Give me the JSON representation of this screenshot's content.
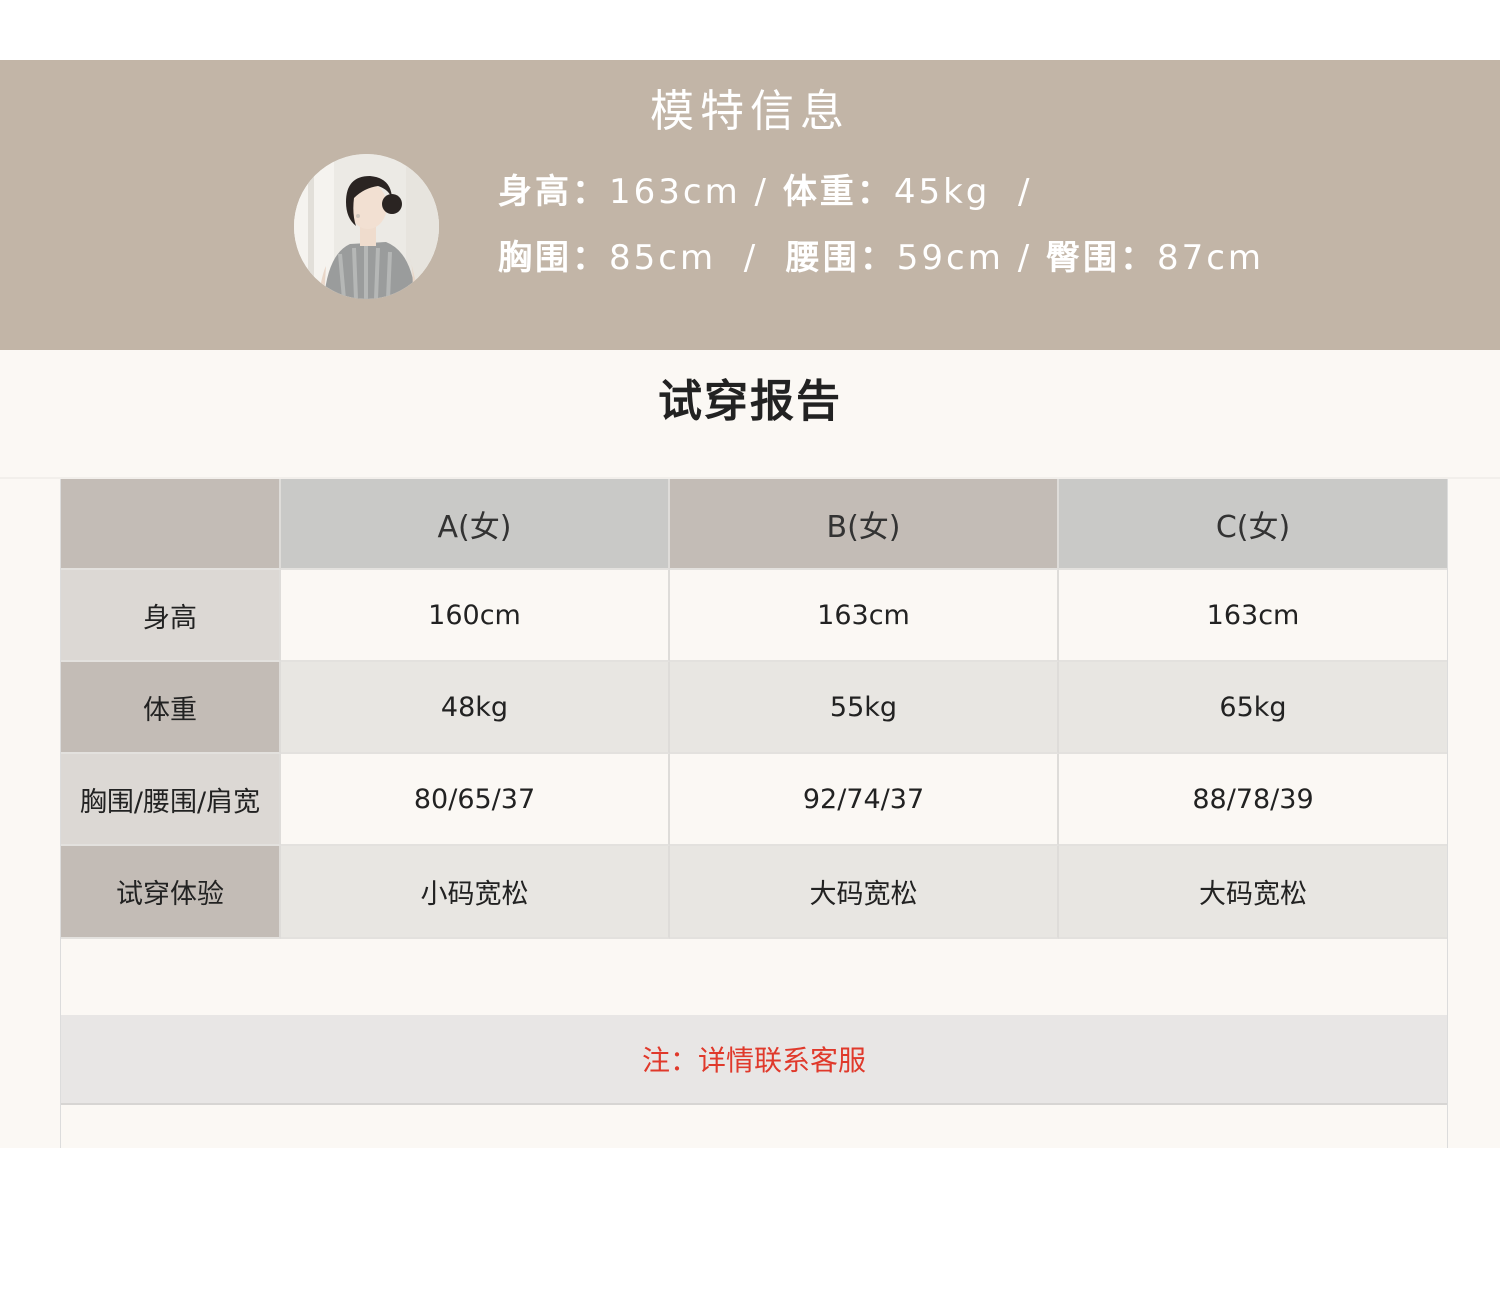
{
  "banner": {
    "title": "模特信息",
    "height_label": "身高：",
    "height_value": "163cm",
    "weight_label": "体重：",
    "weight_value": "45kg",
    "bust_label": "胸围：",
    "bust_value": "85cm",
    "waist_label": "腰围：",
    "waist_value": "59cm",
    "hip_label": "臀围：",
    "hip_value": "87cm",
    "separator": "/"
  },
  "report": {
    "title": "试穿报告",
    "columns": [
      "",
      "A(女)",
      "B(女)",
      "C(女)"
    ],
    "rows": [
      {
        "label": "身高",
        "values": [
          "160cm",
          "163cm",
          "163cm"
        ]
      },
      {
        "label": "体重",
        "values": [
          "48kg",
          "55kg",
          "65kg"
        ]
      },
      {
        "label": "胸围/腰围/肩宽",
        "values": [
          "80/65/37",
          "92/74/37",
          "88/78/39"
        ]
      },
      {
        "label": "试穿体验",
        "values": [
          "小码宽松",
          "大码宽松",
          "大码宽松"
        ]
      }
    ],
    "note": "注：详情联系客服"
  },
  "colors": {
    "banner_bg": "#c2b5a7",
    "note_text": "#e0392b"
  }
}
